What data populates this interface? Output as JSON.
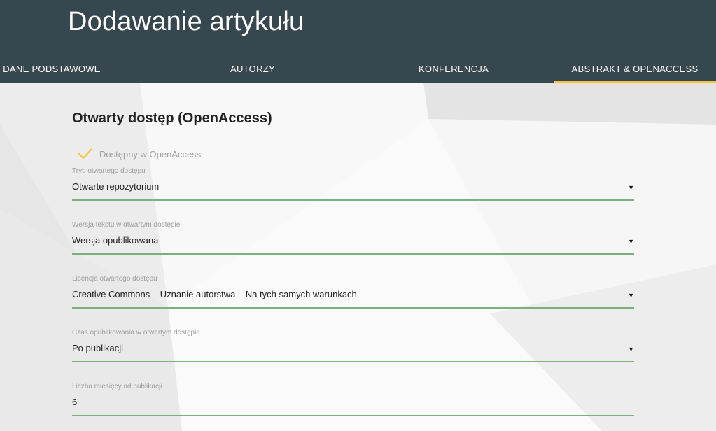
{
  "header": {
    "title": "Dodawanie artykułu",
    "background_color": "#37474f",
    "tabs": [
      {
        "label": "DANE PODSTAWOWE",
        "active": false
      },
      {
        "label": "AUTORZY",
        "active": false
      },
      {
        "label": "KONFERENCJA",
        "active": false
      },
      {
        "label": "ABSTRAKT & OPENACCESS",
        "active": true
      }
    ],
    "active_tab_color": "#f5c542"
  },
  "openaccess": {
    "section_title": "Otwarty dostęp (OpenAccess)",
    "available_checkbox": {
      "label": "Dostępny w OpenAccess",
      "checked": true,
      "icon": "checkmark-icon",
      "color": "#f5c542"
    },
    "fields": [
      {
        "label": "Tryb otwartego dostępu",
        "value": "Otwarte repozytorium",
        "type": "select",
        "icon": "triangle-down-icon"
      },
      {
        "label": "Wersja tekstu w otwartym dostępie",
        "value": "Wersja opublikowana",
        "type": "select",
        "icon": "triangle-down-icon"
      },
      {
        "label": "Licencja otwartego dostępu",
        "value": "Creative Commons – Uznanie autorstwa – Na tych samych warunkach",
        "type": "select",
        "icon": "triangle-down-icon"
      },
      {
        "label": "Czas opublikowania w otwartym dostępie",
        "value": "Po publikacji",
        "type": "select",
        "icon": "triangle-down-icon"
      },
      {
        "label": "Liczba miesięcy od publikacji",
        "value": "6",
        "type": "text"
      }
    ],
    "field_underline_color": "#7cb07c"
  },
  "glyphs": {
    "dropdown_arrow": "▼"
  }
}
